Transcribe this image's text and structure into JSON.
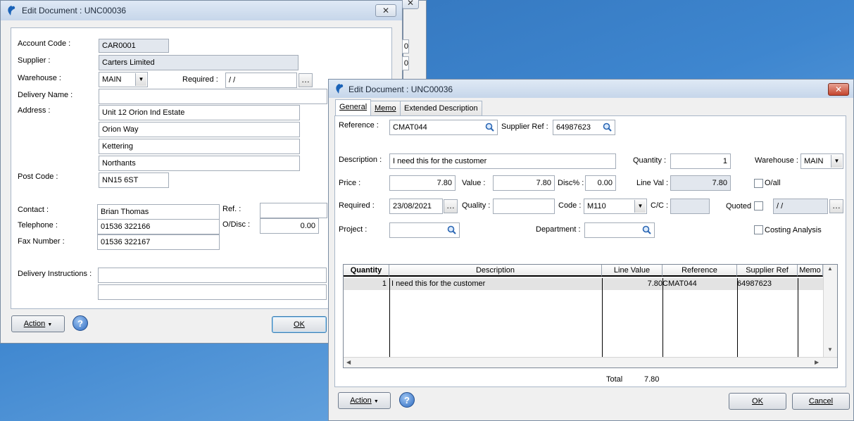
{
  "back_window": {
    "title": "Edit Document : UNC00036",
    "fields": {
      "account_code_label": "Account Code :",
      "account_code": "CAR0001",
      "supplier_label": "Supplier :",
      "supplier": "Carters Limited",
      "warehouse_label": "Warehouse :",
      "warehouse": "MAIN",
      "required_label": "Required :",
      "required": " / /",
      "delivery_name_label": "Delivery Name :",
      "delivery_name": "",
      "address_label": "Address :",
      "address": [
        "Unit 12 Orion Ind Estate",
        "Orion Way",
        "Kettering",
        "Northants"
      ],
      "post_code_label": "Post Code :",
      "post_code": "NN15 6ST",
      "contact_label": "Contact :",
      "contact": "Brian Thomas",
      "ref_label": "Ref. :",
      "ref": "",
      "telephone_label": "Telephone :",
      "telephone": "01536 322166",
      "odisc_label": "O/Disc :",
      "odisc": "0.00",
      "fax_label": "Fax Number :",
      "fax": "01536 322167",
      "delivery_instructions_label": "Delivery Instructions :",
      "delivery_instructions": [
        "",
        ""
      ]
    },
    "action_label": "Action",
    "ok_label": "OK",
    "side_values": [
      "0",
      "0"
    ]
  },
  "front_window": {
    "title": "Edit Document : UNC00036",
    "tabs": [
      "General",
      "Memo",
      "Extended Description"
    ],
    "fields": {
      "reference_label": "Reference :",
      "reference": "CMAT044",
      "supplier_ref_label": "Supplier Ref :",
      "supplier_ref": "64987623",
      "description_label": "Description :",
      "description": "I need this for the customer",
      "quantity_label": "Quantity :",
      "quantity": "1",
      "warehouse_label": "Warehouse :",
      "warehouse": "MAIN",
      "price_label": "Price :",
      "price": "7.80",
      "value_label": "Value :",
      "value": "7.80",
      "disc_label": "Disc% :",
      "disc": "0.00",
      "line_val_label": "Line Val :",
      "line_val": "7.80",
      "oall_label": "O/all",
      "required_label": "Required :",
      "required": "23/08/2021",
      "quality_label": "Quality :",
      "quality": "",
      "code_label": "Code :",
      "code": "M110",
      "cc_label": "C/C :",
      "cc": "",
      "quoted_label": "Quoted",
      "quoted_date": " / /",
      "project_label": "Project :",
      "project": "",
      "department_label": "Department :",
      "department": "",
      "costing_label": "Costing Analysis"
    },
    "grid": {
      "headers": [
        "Quantity",
        "Description",
        "Line Value",
        "Reference",
        "Supplier Ref",
        "Memo"
      ],
      "rows": [
        {
          "quantity": "1",
          "description": "I need this for the customer",
          "line_value": "7.80",
          "reference": "CMAT044",
          "supplier_ref": "64987623",
          "memo": ""
        }
      ]
    },
    "total_label": "Total",
    "total": "7.80",
    "action_label": "Action",
    "ok_label": "OK",
    "cancel_label": "Cancel"
  }
}
